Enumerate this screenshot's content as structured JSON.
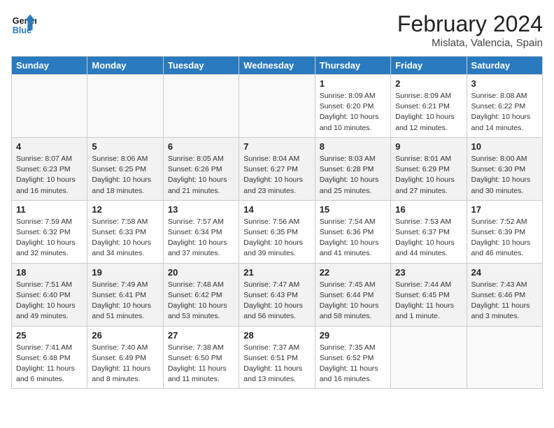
{
  "header": {
    "logo_line1": "General",
    "logo_line2": "Blue",
    "title": "February 2024",
    "subtitle": "Mislata, Valencia, Spain"
  },
  "days_of_week": [
    "Sunday",
    "Monday",
    "Tuesday",
    "Wednesday",
    "Thursday",
    "Friday",
    "Saturday"
  ],
  "weeks": [
    [
      {
        "day": "",
        "info": ""
      },
      {
        "day": "",
        "info": ""
      },
      {
        "day": "",
        "info": ""
      },
      {
        "day": "",
        "info": ""
      },
      {
        "day": "1",
        "info": "Sunrise: 8:09 AM\nSunset: 6:20 PM\nDaylight: 10 hours\nand 10 minutes."
      },
      {
        "day": "2",
        "info": "Sunrise: 8:09 AM\nSunset: 6:21 PM\nDaylight: 10 hours\nand 12 minutes."
      },
      {
        "day": "3",
        "info": "Sunrise: 8:08 AM\nSunset: 6:22 PM\nDaylight: 10 hours\nand 14 minutes."
      }
    ],
    [
      {
        "day": "4",
        "info": "Sunrise: 8:07 AM\nSunset: 6:23 PM\nDaylight: 10 hours\nand 16 minutes."
      },
      {
        "day": "5",
        "info": "Sunrise: 8:06 AM\nSunset: 6:25 PM\nDaylight: 10 hours\nand 18 minutes."
      },
      {
        "day": "6",
        "info": "Sunrise: 8:05 AM\nSunset: 6:26 PM\nDaylight: 10 hours\nand 21 minutes."
      },
      {
        "day": "7",
        "info": "Sunrise: 8:04 AM\nSunset: 6:27 PM\nDaylight: 10 hours\nand 23 minutes."
      },
      {
        "day": "8",
        "info": "Sunrise: 8:03 AM\nSunset: 6:28 PM\nDaylight: 10 hours\nand 25 minutes."
      },
      {
        "day": "9",
        "info": "Sunrise: 8:01 AM\nSunset: 6:29 PM\nDaylight: 10 hours\nand 27 minutes."
      },
      {
        "day": "10",
        "info": "Sunrise: 8:00 AM\nSunset: 6:30 PM\nDaylight: 10 hours\nand 30 minutes."
      }
    ],
    [
      {
        "day": "11",
        "info": "Sunrise: 7:59 AM\nSunset: 6:32 PM\nDaylight: 10 hours\nand 32 minutes."
      },
      {
        "day": "12",
        "info": "Sunrise: 7:58 AM\nSunset: 6:33 PM\nDaylight: 10 hours\nand 34 minutes."
      },
      {
        "day": "13",
        "info": "Sunrise: 7:57 AM\nSunset: 6:34 PM\nDaylight: 10 hours\nand 37 minutes."
      },
      {
        "day": "14",
        "info": "Sunrise: 7:56 AM\nSunset: 6:35 PM\nDaylight: 10 hours\nand 39 minutes."
      },
      {
        "day": "15",
        "info": "Sunrise: 7:54 AM\nSunset: 6:36 PM\nDaylight: 10 hours\nand 41 minutes."
      },
      {
        "day": "16",
        "info": "Sunrise: 7:53 AM\nSunset: 6:37 PM\nDaylight: 10 hours\nand 44 minutes."
      },
      {
        "day": "17",
        "info": "Sunrise: 7:52 AM\nSunset: 6:39 PM\nDaylight: 10 hours\nand 46 minutes."
      }
    ],
    [
      {
        "day": "18",
        "info": "Sunrise: 7:51 AM\nSunset: 6:40 PM\nDaylight: 10 hours\nand 49 minutes."
      },
      {
        "day": "19",
        "info": "Sunrise: 7:49 AM\nSunset: 6:41 PM\nDaylight: 10 hours\nand 51 minutes."
      },
      {
        "day": "20",
        "info": "Sunrise: 7:48 AM\nSunset: 6:42 PM\nDaylight: 10 hours\nand 53 minutes."
      },
      {
        "day": "21",
        "info": "Sunrise: 7:47 AM\nSunset: 6:43 PM\nDaylight: 10 hours\nand 56 minutes."
      },
      {
        "day": "22",
        "info": "Sunrise: 7:45 AM\nSunset: 6:44 PM\nDaylight: 10 hours\nand 58 minutes."
      },
      {
        "day": "23",
        "info": "Sunrise: 7:44 AM\nSunset: 6:45 PM\nDaylight: 11 hours\nand 1 minute."
      },
      {
        "day": "24",
        "info": "Sunrise: 7:43 AM\nSunset: 6:46 PM\nDaylight: 11 hours\nand 3 minutes."
      }
    ],
    [
      {
        "day": "25",
        "info": "Sunrise: 7:41 AM\nSunset: 6:48 PM\nDaylight: 11 hours\nand 6 minutes."
      },
      {
        "day": "26",
        "info": "Sunrise: 7:40 AM\nSunset: 6:49 PM\nDaylight: 11 hours\nand 8 minutes."
      },
      {
        "day": "27",
        "info": "Sunrise: 7:38 AM\nSunset: 6:50 PM\nDaylight: 11 hours\nand 11 minutes."
      },
      {
        "day": "28",
        "info": "Sunrise: 7:37 AM\nSunset: 6:51 PM\nDaylight: 11 hours\nand 13 minutes."
      },
      {
        "day": "29",
        "info": "Sunrise: 7:35 AM\nSunset: 6:52 PM\nDaylight: 11 hours\nand 16 minutes."
      },
      {
        "day": "",
        "info": ""
      },
      {
        "day": "",
        "info": ""
      }
    ]
  ]
}
